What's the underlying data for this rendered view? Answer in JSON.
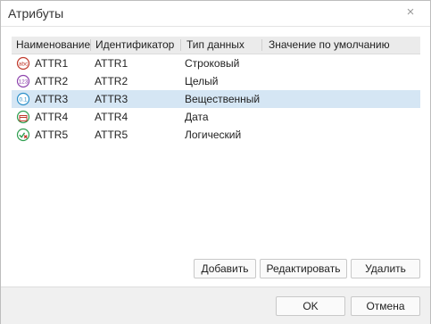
{
  "window": {
    "title": "Атрибуты",
    "close_glyph": "×"
  },
  "table": {
    "columns": [
      "Наименование",
      "Идентификатор",
      "Тип данных",
      "Значение по умолчанию"
    ],
    "rows": [
      {
        "name": "ATTR1",
        "id": "ATTR1",
        "type": "Строковый",
        "default": "",
        "icon": "string-type-icon",
        "icon_text": "abc"
      },
      {
        "name": "ATTR2",
        "id": "ATTR2",
        "type": "Целый",
        "default": "",
        "icon": "integer-type-icon",
        "icon_text": "123"
      },
      {
        "name": "ATTR3",
        "id": "ATTR3",
        "type": "Вещественный",
        "default": "",
        "icon": "real-type-icon",
        "icon_text": "0.1",
        "selected": true
      },
      {
        "name": "ATTR4",
        "id": "ATTR4",
        "type": "Дата",
        "default": "",
        "icon": "date-type-icon",
        "icon_text": ""
      },
      {
        "name": "ATTR5",
        "id": "ATTR5",
        "type": "Логический",
        "default": "",
        "icon": "boolean-type-icon",
        "icon_text": ""
      }
    ]
  },
  "actions": {
    "add": "Добавить",
    "edit": "Редактировать",
    "delete": "Удалить"
  },
  "footer": {
    "ok": "OK",
    "cancel": "Отмена"
  },
  "colors": {
    "selection": "#d5e6f4",
    "header_bg": "#ebebeb",
    "footer_bg": "#f0f0f0"
  }
}
